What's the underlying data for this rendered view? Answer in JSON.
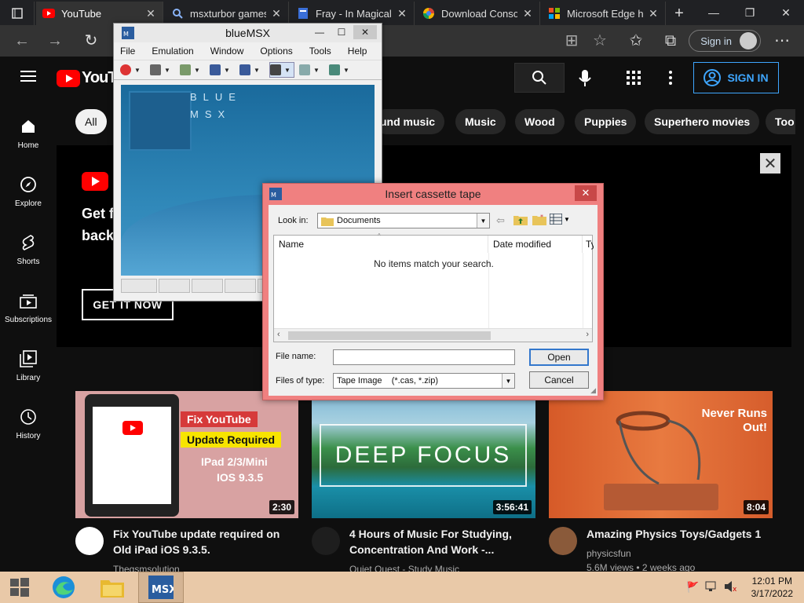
{
  "browser": {
    "tabs": [
      {
        "title": "YouTube",
        "icon": "youtube-icon",
        "active": true
      },
      {
        "title": "msxturbor games",
        "icon": "search-icon"
      },
      {
        "title": "Fray - In Magical",
        "icon": "document-icon"
      },
      {
        "title": "Download Conso",
        "icon": "chrome-icon"
      },
      {
        "title": "Microsoft Edge h",
        "icon": "microsoft-icon"
      }
    ],
    "new_tab": "+",
    "signin_label": "Sign in",
    "more": "⋯"
  },
  "youtube": {
    "logo_text": "YouTube",
    "signin_label": "SIGN IN",
    "chips": [
      "All",
      "und music",
      "Music",
      "Wood",
      "Puppies",
      "Superhero movies",
      "Too"
    ],
    "sidebar": [
      {
        "label": "Home",
        "icon": "home-icon"
      },
      {
        "label": "Explore",
        "icon": "compass-icon"
      },
      {
        "label": "Shorts",
        "icon": "shorts-icon"
      },
      {
        "label": "Subscriptions",
        "icon": "subscriptions-icon"
      },
      {
        "label": "Library",
        "icon": "library-icon"
      },
      {
        "label": "History",
        "icon": "history-icon"
      }
    ],
    "banner": {
      "line1": "Get f",
      "line2": "back",
      "button": "GET IT NOW",
      "close": "✕"
    },
    "videos": [
      {
        "thumb_text_1": "Fix YouTube",
        "thumb_text_2": "Update Required",
        "thumb_text_3": "IPad 2/3/Mini",
        "thumb_text_4": "IOS 9.3.5",
        "duration": "2:30",
        "title": "Fix YouTube update required on Old iPad iOS 9.3.5.",
        "channel": "Thegsmsolution"
      },
      {
        "thumb_text": "DEEP FOCUS",
        "duration": "3:56:41",
        "title": "4 Hours of Music For Studying, Concentration And Work -...",
        "channel": "Quiet Quest - Study Music"
      },
      {
        "thumb_text": "Never Runs Out!",
        "duration": "8:04",
        "title": "Amazing Physics Toys/Gadgets 1",
        "channel": "physicsfun",
        "meta": "5.6M views • 2 weeks ago"
      }
    ]
  },
  "bluemsx": {
    "title": "blueMSX",
    "menu": [
      "File",
      "Emulation",
      "Window",
      "Options",
      "Tools",
      "Help"
    ],
    "screen_logo_1": "BLUE",
    "screen_logo_2": "MSX"
  },
  "dialog": {
    "title": "Insert cassette tape",
    "look_in_label": "Look in:",
    "look_in_value": "Documents",
    "col_name": "Name",
    "col_date": "Date modified",
    "col_type": "Ty",
    "empty_message": "No items match your search.",
    "filename_label": "File name:",
    "filename_value": "",
    "filetype_label": "Files of type:",
    "filetype_value": "Tape Image    (*.cas, *.zip)",
    "open": "Open",
    "cancel": "Cancel"
  },
  "taskbar": {
    "time": "12:01 PM",
    "date": "3/17/2022"
  }
}
